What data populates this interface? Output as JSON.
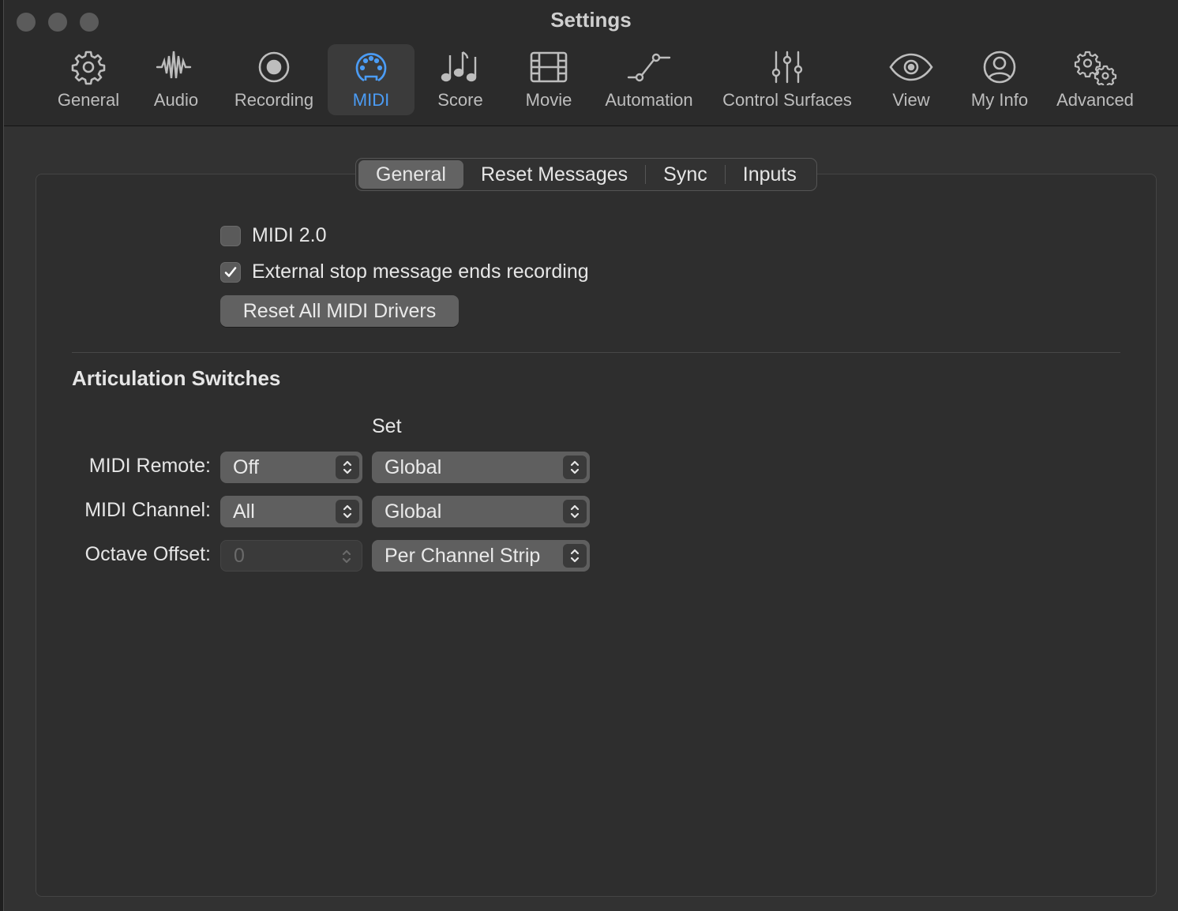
{
  "window": {
    "title": "Settings"
  },
  "toolbar": {
    "items": [
      {
        "label": "General",
        "icon": "gear-icon"
      },
      {
        "label": "Audio",
        "icon": "waveform-icon"
      },
      {
        "label": "Recording",
        "icon": "record-icon"
      },
      {
        "label": "MIDI",
        "icon": "midi-connector-icon",
        "active": true
      },
      {
        "label": "Score",
        "icon": "music-notes-icon"
      },
      {
        "label": "Movie",
        "icon": "film-icon"
      },
      {
        "label": "Automation",
        "icon": "automation-curve-icon"
      },
      {
        "label": "Control Surfaces",
        "icon": "sliders-icon"
      },
      {
        "label": "View",
        "icon": "eye-icon"
      },
      {
        "label": "My Info",
        "icon": "person-icon"
      },
      {
        "label": "Advanced",
        "icon": "gears-icon"
      }
    ],
    "accent_color": "#4b9cf5"
  },
  "tabs": {
    "items": [
      {
        "label": "General",
        "active": true
      },
      {
        "label": "Reset Messages"
      },
      {
        "label": "Sync"
      },
      {
        "label": "Inputs"
      }
    ]
  },
  "general": {
    "midi2_label": "MIDI 2.0",
    "midi2_checked": false,
    "external_stop_label": "External stop message ends recording",
    "external_stop_checked": true,
    "reset_button_label": "Reset All MIDI Drivers"
  },
  "articulation": {
    "title": "Articulation Switches",
    "set_header": "Set",
    "rows": [
      {
        "label": "MIDI Remote:",
        "value": "Off",
        "set": "Global",
        "disabled": false
      },
      {
        "label": "MIDI Channel:",
        "value": "All",
        "set": "Global",
        "disabled": false
      },
      {
        "label": "Octave Offset:",
        "value": "0",
        "set": "Per Channel Strip",
        "disabled": true
      }
    ]
  }
}
